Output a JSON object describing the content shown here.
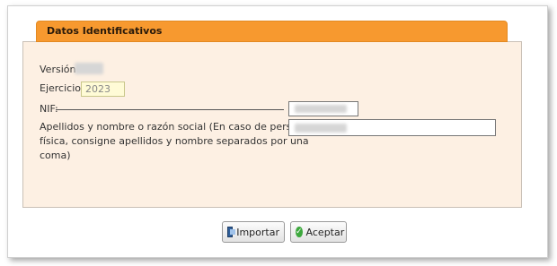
{
  "panel": {
    "title": "Datos Identificativos"
  },
  "form": {
    "version_label": "Versión",
    "exercise_label": "Ejercicio",
    "exercise_value": "2023",
    "nif_label": "NIF:",
    "name_label_line1": "Apellidos y nombre o razón social (En caso de persona",
    "name_label_line2": "física, consigne apellidos y nombre separados por una",
    "name_label_line3": "coma)"
  },
  "buttons": {
    "import_label": "Importar",
    "accept_label": "Aceptar"
  }
}
